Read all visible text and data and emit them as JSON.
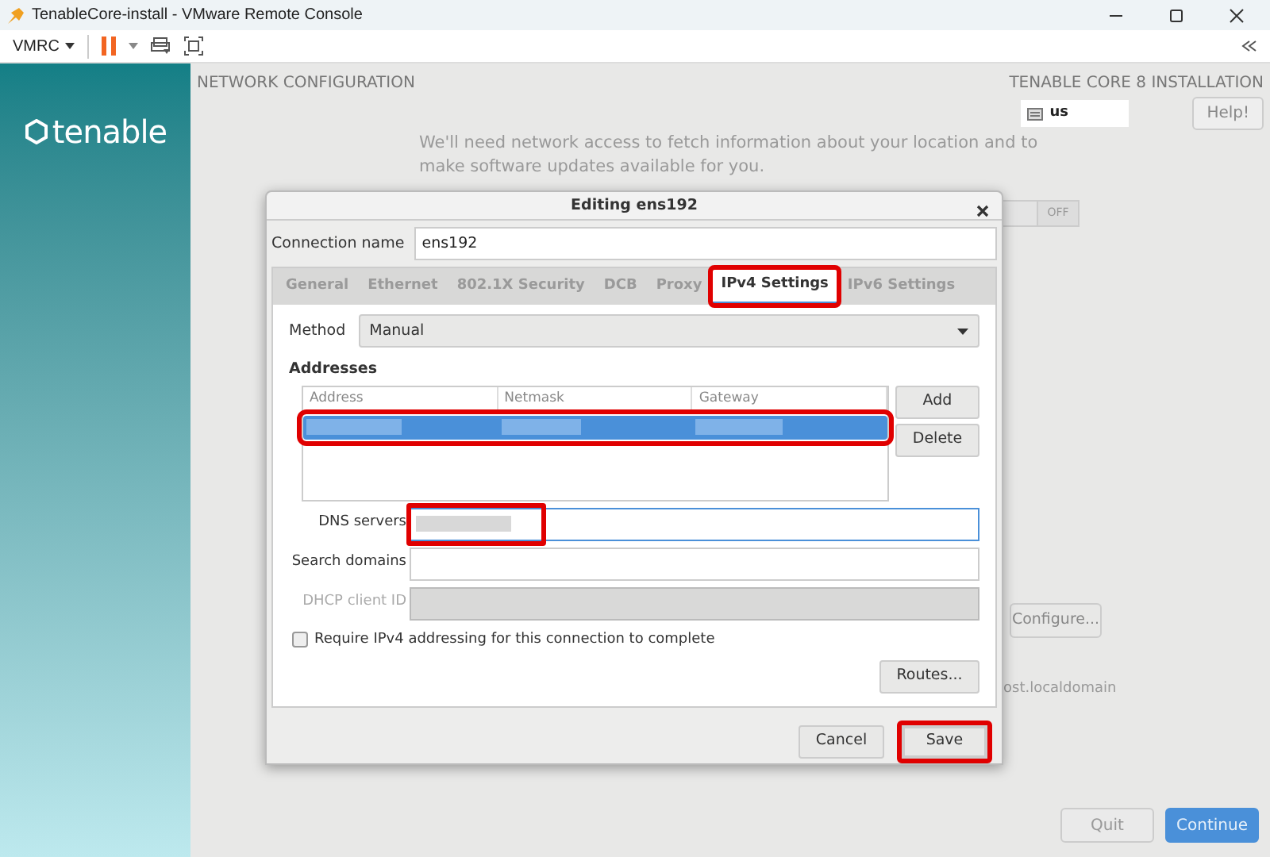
{
  "window": {
    "title": "TenableCore-install - VMware Remote Console"
  },
  "toolbar": {
    "menu": "VMRC"
  },
  "sidebar": {
    "logo": "tenable"
  },
  "header": {
    "section": "NETWORK CONFIGURATION",
    "product": "TENABLE CORE 8 INSTALLATION",
    "keyboard": "us",
    "help": "Help!"
  },
  "intro": "We'll need network access to fetch information about your location and to make software updates available for you.",
  "toggle": {
    "label": "OFF",
    "on": false
  },
  "configure_button": "Configure...",
  "hostname": "ost.localdomain",
  "footer_buttons": [
    {
      "label": "Quit",
      "kind": "secondary"
    },
    {
      "label": "Continue",
      "kind": "primary"
    }
  ],
  "dialog": {
    "title": "Editing ens192",
    "connection_name_label": "Connection name",
    "connection_name": "ens192",
    "tabs": [
      {
        "label": "General",
        "selected": false,
        "highlighted": false
      },
      {
        "label": "Ethernet",
        "selected": false,
        "highlighted": false
      },
      {
        "label": "802.1X Security",
        "selected": false,
        "highlighted": false
      },
      {
        "label": "DCB",
        "selected": false,
        "highlighted": false
      },
      {
        "label": "Proxy",
        "selected": false,
        "highlighted": false
      },
      {
        "label": "IPv4 Settings",
        "selected": true,
        "highlighted": true
      },
      {
        "label": "IPv6 Settings",
        "selected": false,
        "highlighted": false
      }
    ],
    "method_label": "Method",
    "method": "Manual",
    "addresses_heading": "Addresses",
    "address_columns": [
      "Address",
      "Netmask",
      "Gateway"
    ],
    "address_rows": [
      {
        "selected": true,
        "highlighted": true
      }
    ],
    "address_buttons": [
      "Add",
      "Delete"
    ],
    "fields": [
      {
        "label": "DNS servers",
        "kind": "blurred",
        "focused": true,
        "disabled": false,
        "highlighted": true
      },
      {
        "label": "Search domains",
        "kind": "empty",
        "focused": false,
        "disabled": false,
        "highlighted": false
      },
      {
        "label": "DHCP client ID",
        "kind": "empty",
        "focused": false,
        "disabled": true,
        "highlighted": false
      }
    ],
    "require_ipv4": {
      "label": "Require IPv4 addressing for this connection to complete",
      "checked": false
    },
    "routes_button": "Routes...",
    "buttons": [
      {
        "label": "Cancel",
        "highlighted": false
      },
      {
        "label": "Save",
        "highlighted": true
      }
    ]
  }
}
